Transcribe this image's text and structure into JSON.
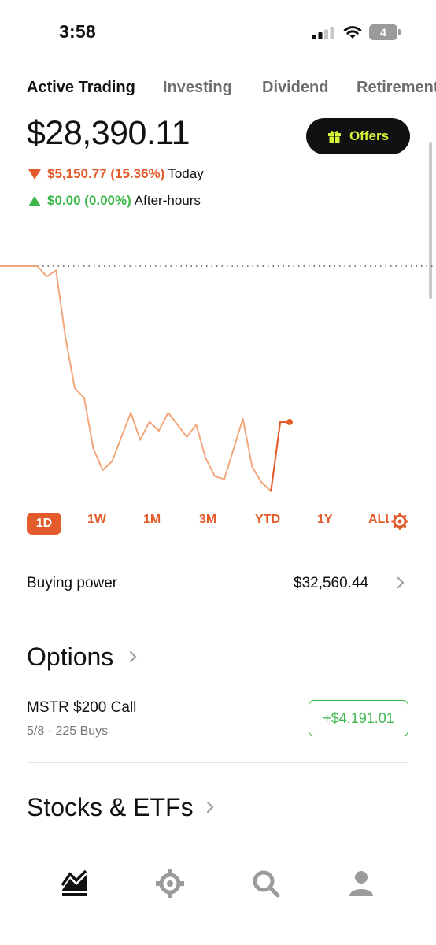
{
  "status_bar": {
    "time": "3:58",
    "battery": "4"
  },
  "tabs": [
    {
      "label": "Active Trading",
      "active": true
    },
    {
      "label": "Investing",
      "active": false
    },
    {
      "label": "Dividend",
      "active": false
    },
    {
      "label": "Retirement",
      "active": false
    }
  ],
  "account": {
    "balance": "$28,390.11",
    "offers_label": "Offers",
    "today_change": "$5,150.77 (15.36%)",
    "today_label": "Today",
    "after_change": "$0.00 (0.00%)",
    "after_label": "After-hours"
  },
  "chart_data": {
    "type": "line",
    "title": "",
    "xlabel": "",
    "ylabel": "",
    "baseline": "previous close (dotted)",
    "color": "#e35b2a",
    "series": [
      {
        "values": [
          33540,
          33540,
          33540,
          33540,
          33540,
          33200,
          33400,
          31200,
          29500,
          29200,
          27500,
          26800,
          27100,
          27900,
          28700,
          27800,
          28400,
          28100,
          28700,
          28300,
          27900,
          28300,
          27200,
          26600,
          26500,
          27500,
          28500,
          26900,
          26400,
          26100,
          28390,
          28390
        ]
      }
    ]
  },
  "ranges": [
    {
      "label": "1D",
      "active": true
    },
    {
      "label": "1W",
      "active": false
    },
    {
      "label": "1M",
      "active": false
    },
    {
      "label": "3M",
      "active": false
    },
    {
      "label": "YTD",
      "active": false
    },
    {
      "label": "1Y",
      "active": false
    },
    {
      "label": "ALL",
      "active": false
    }
  ],
  "buying_power": {
    "label": "Buying power",
    "value": "$32,560.44"
  },
  "options": {
    "title": "Options",
    "items": [
      {
        "name": "MSTR $200 Call",
        "sub": "5/8 · 225 Buys",
        "gain": "+$4,191.01"
      }
    ]
  },
  "stocks": {
    "title": "Stocks & ETFs"
  },
  "bottom_nav": [
    "chart-icon",
    "crypto-icon",
    "search-icon",
    "profile-icon"
  ]
}
